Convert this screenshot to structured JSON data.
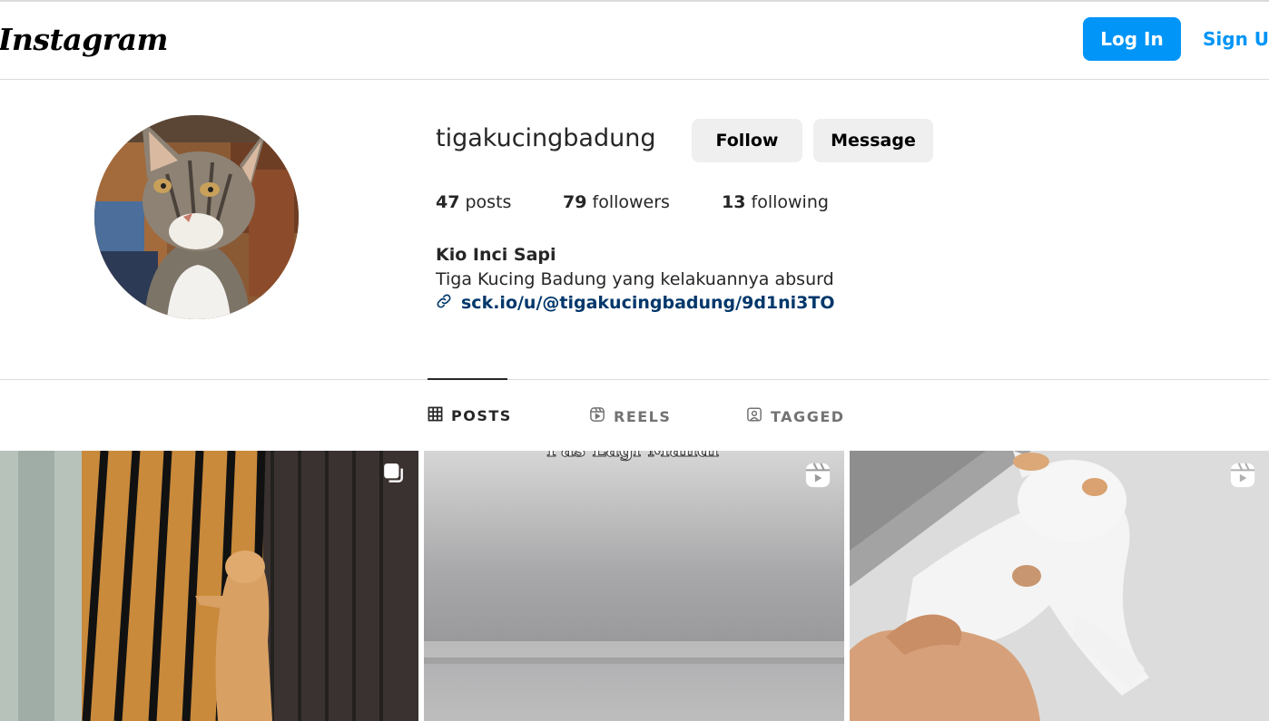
{
  "header": {
    "logo": "Instagram",
    "login_label": "Log In",
    "signup_label": "Sign Up",
    "accent_color": "#0095f6"
  },
  "profile": {
    "username": "tigakucingbadung",
    "follow_label": "Follow",
    "message_label": "Message",
    "stats": {
      "posts_count": "47",
      "posts_label": "posts",
      "followers_count": "79",
      "followers_label": "followers",
      "following_count": "13",
      "following_label": "following"
    },
    "full_name": "Kio Inci Sapi",
    "bio": "Tiga Kucing Badung yang kelakuannya absurd",
    "link": "sck.io/u/@tigakucingbadung/9d1ni3TO",
    "link_icon": "link-icon"
  },
  "tabs": [
    {
      "label": "POSTS",
      "icon": "grid-icon",
      "active": true
    },
    {
      "label": "REELS",
      "icon": "reels-icon",
      "active": false
    },
    {
      "label": "TAGGED",
      "icon": "tagged-icon",
      "active": false
    }
  ],
  "posts": [
    {
      "type": "carousel",
      "badge_icon": "carousel-icon"
    },
    {
      "type": "reel",
      "badge_icon": "reels-icon",
      "caption": "Pas Lagi Mandi"
    },
    {
      "type": "reel",
      "badge_icon": "reels-icon"
    }
  ]
}
